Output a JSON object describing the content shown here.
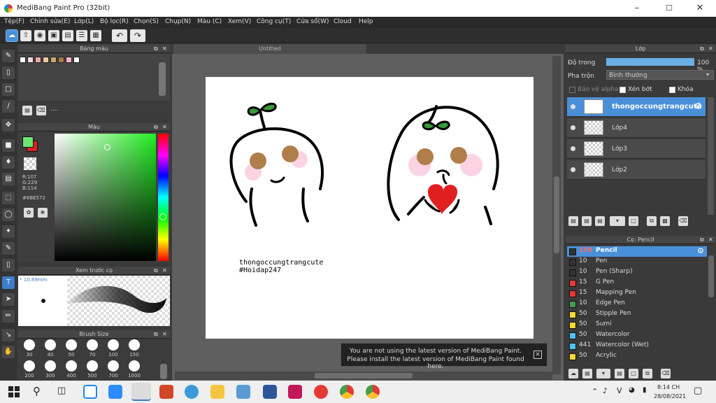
{
  "window": {
    "title": "MediBang Paint Pro (32bit)"
  },
  "menu": [
    "Tệp(F)",
    "Chỉnh sửa(E)",
    "Lớp(L)",
    "Bộ lọc(R)",
    "Chọn(S)",
    "Chụp(N)",
    "Màu (C)",
    "Xem(V)",
    "Công cụ(T)",
    "Cửa sổ(W)",
    "Cloud",
    "Help"
  ],
  "panels": {
    "palette": {
      "title": "Bảng màu",
      "dots": "...."
    },
    "color": {
      "title": "Màu",
      "r": "R:107",
      "g": "G:229",
      "b": "B:114",
      "hex": "#6BE572",
      "main_color": "#6BE572",
      "secondary_color": "#e02020"
    },
    "preview": {
      "title": "Xem trước cọ",
      "size": "10.89mm"
    },
    "brush_size": {
      "title": "Brush Size",
      "sizes": [
        "30",
        "40",
        "50",
        "70",
        "100",
        "150",
        "200",
        "300",
        "400",
        "500",
        "700",
        "1000"
      ]
    }
  },
  "canvas": {
    "tab": "Untitled",
    "caption_line1": "thongoccungtrangcute",
    "caption_line2": "#Hoidap247"
  },
  "notification": {
    "line1": "You are not using the latest version of MediBang Paint.",
    "line2": "Please install the latest version of MediBang Paint found here."
  },
  "layers": {
    "title": "Lớp",
    "opacity_label": "Độ trong",
    "opacity_value": "100 %",
    "opacity": 1.0,
    "blend_label": "Pha trộn",
    "blend_value": "Bình thường",
    "protect_alpha": "Bảo vệ alpha",
    "clipping": "Xén bớt",
    "lock": "Khóa",
    "items": [
      {
        "name": "thongoccungtrangcute",
        "selected": true
      },
      {
        "name": "Lớp4",
        "selected": false
      },
      {
        "name": "Lớp3",
        "selected": false
      },
      {
        "name": "Lớp2",
        "selected": false
      }
    ]
  },
  "brushes": {
    "title": "Cọ: Pencil",
    "items": [
      {
        "size": "150",
        "name": "Pencil",
        "color": "#333333",
        "selected": true
      },
      {
        "size": "10",
        "name": "Pen",
        "color": "#333333"
      },
      {
        "size": "10",
        "name": "Pen (Sharp)",
        "color": "#333333"
      },
      {
        "size": "15",
        "name": "G Pen",
        "color": "#e53935"
      },
      {
        "size": "15",
        "name": "Mapping Pen",
        "color": "#e53935"
      },
      {
        "size": "10",
        "name": "Edge Pen",
        "color": "#43a047"
      },
      {
        "size": "50",
        "name": "Stipple Pen",
        "color": "#fdd835"
      },
      {
        "size": "50",
        "name": "Sumi",
        "color": "#fdd835"
      },
      {
        "size": "50",
        "name": "Watercolor",
        "color": "#4fc3f7"
      },
      {
        "size": "441",
        "name": "Watercolor (Wet)",
        "color": "#4fc3f7"
      },
      {
        "size": "50",
        "name": "Acrylic",
        "color": "#fdd835"
      }
    ]
  },
  "taskbar": {
    "time": "8:14 CH",
    "date": "28/08/2021",
    "lang": "V"
  }
}
